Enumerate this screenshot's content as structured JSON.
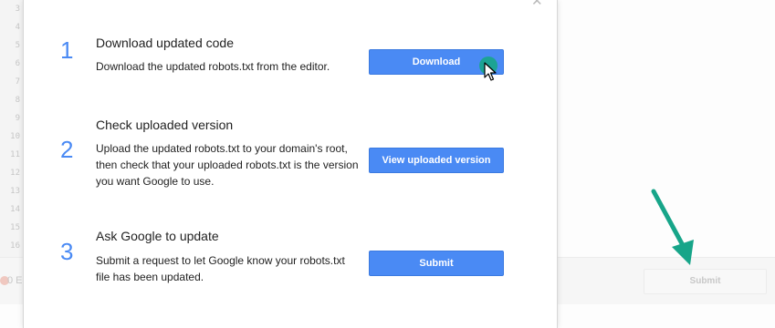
{
  "editor": {
    "line_numbers": [
      "3",
      "4",
      "5",
      "6",
      "7",
      "8",
      "9",
      "10",
      "11",
      "12",
      "13",
      "14",
      "15",
      "16"
    ],
    "error_text": "0 E",
    "submit_label": "Submit"
  },
  "dialog": {
    "steps": [
      {
        "number": "1",
        "title": "Download updated code",
        "description": "Download the updated robots.txt from the editor.",
        "button_label": "Download"
      },
      {
        "number": "2",
        "title": "Check uploaded version",
        "description": "Upload the updated robots.txt to your domain's root, then check that your uploaded robots.txt is the version you want Google to use.",
        "button_label": "View uploaded version"
      },
      {
        "number": "3",
        "title": "Ask Google to update",
        "description": "Submit a request to let Google know your robots.txt file has been updated.",
        "button_label": "Submit"
      }
    ]
  },
  "colors": {
    "accent_blue": "#4a8af4",
    "annotation_green": "#17a589"
  },
  "icons": {
    "close": "close-icon",
    "cursor": "mouse-cursor-icon",
    "annotation": "arrow-annotation-icon"
  }
}
